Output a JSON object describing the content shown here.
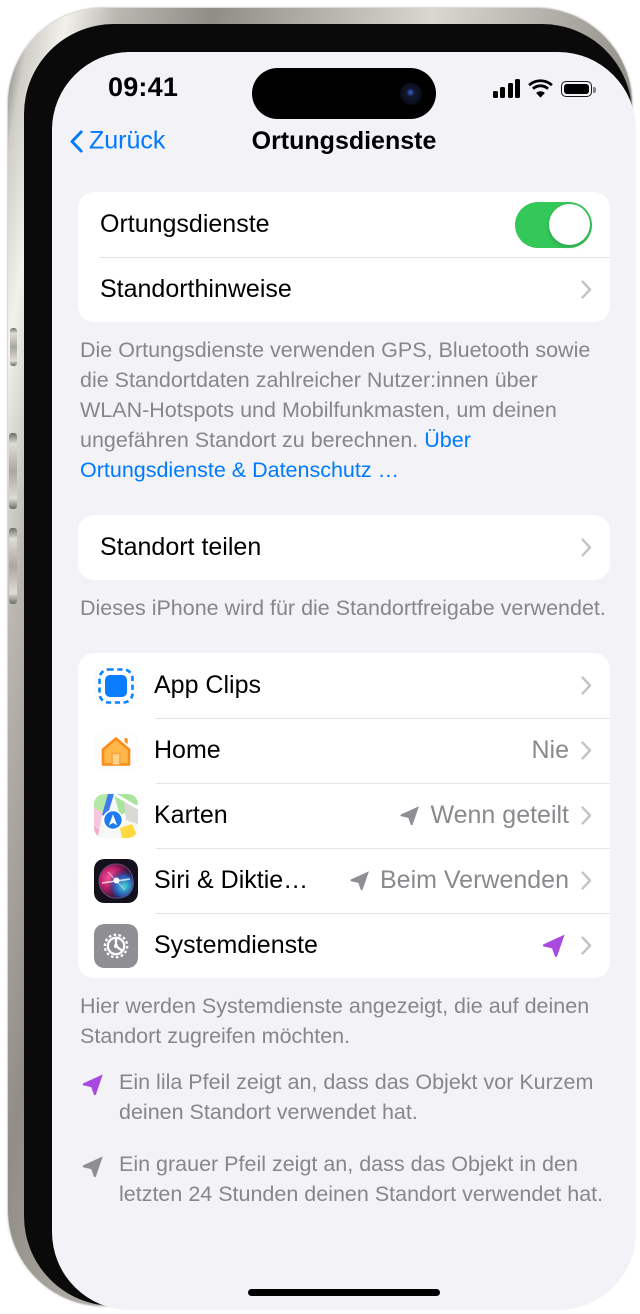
{
  "status_bar": {
    "time": "09:41",
    "cellular_icon": "cellular-bars-icon",
    "wifi_icon": "wifi-icon",
    "battery_icon": "battery-full-icon"
  },
  "nav_bar": {
    "back_label": "Zurück",
    "back_icon": "chevron-left-icon",
    "title": "Ortungsdienste"
  },
  "colors": {
    "accent_blue": "#007aff",
    "toggle_green": "#34c759",
    "purple_arrow": "#a84ae0",
    "gray_arrow": "#8e8e93",
    "page_background": "#f2f2f7",
    "group_background": "#ffffff",
    "footer_text": "#86868b",
    "value_text": "#8a8a8e"
  },
  "group_main": {
    "rows": [
      {
        "label": "Ortungsdienste",
        "control": "toggle",
        "toggle_on": true
      },
      {
        "label": "Standorthinweise",
        "control": "chevron"
      }
    ]
  },
  "footer_main": {
    "text": "Die Ortungsdienste verwenden GPS, Bluetooth sowie die Standortdaten zahlreicher Nutzer:innen über WLAN-Hotspots und Mobilfunkmasten, um deinen ungefähren Standort zu berechnen. ",
    "link": "Über Ortungsdienste & Datenschutz …"
  },
  "group_share": {
    "rows": [
      {
        "label": "Standort teilen",
        "control": "chevron"
      }
    ]
  },
  "footer_share": {
    "text": "Dieses iPhone wird für die Standortfreigabe verwendet."
  },
  "group_apps": {
    "rows": [
      {
        "label": "App Clips",
        "value": "",
        "icon": "app-clips-icon",
        "arrow": "none"
      },
      {
        "label": "Home",
        "value": "Nie",
        "icon": "home-app-icon",
        "arrow": "none"
      },
      {
        "label": "Karten",
        "value": "Wenn geteilt",
        "icon": "maps-app-icon",
        "arrow": "gray"
      },
      {
        "label": "Siri & Diktie…",
        "value": "Beim Verwenden",
        "icon": "siri-app-icon",
        "arrow": "gray"
      },
      {
        "label": "Systemdienste",
        "value": "",
        "icon": "system-services-icon",
        "arrow": "purple"
      }
    ]
  },
  "footer_apps": {
    "text": "Hier werden Systemdienste angezeigt, die auf deinen Standort zugreifen möchten."
  },
  "legend": {
    "items": [
      {
        "arrow": "purple",
        "text": "Ein lila Pfeil zeigt an, dass das Objekt vor Kurzem deinen Standort verwendet hat."
      },
      {
        "arrow": "gray",
        "text": "Ein grauer Pfeil zeigt an, dass das Objekt in den letzten 24 Stunden deinen Standort verwendet hat."
      }
    ]
  },
  "home_indicator": "home-indicator-bar"
}
